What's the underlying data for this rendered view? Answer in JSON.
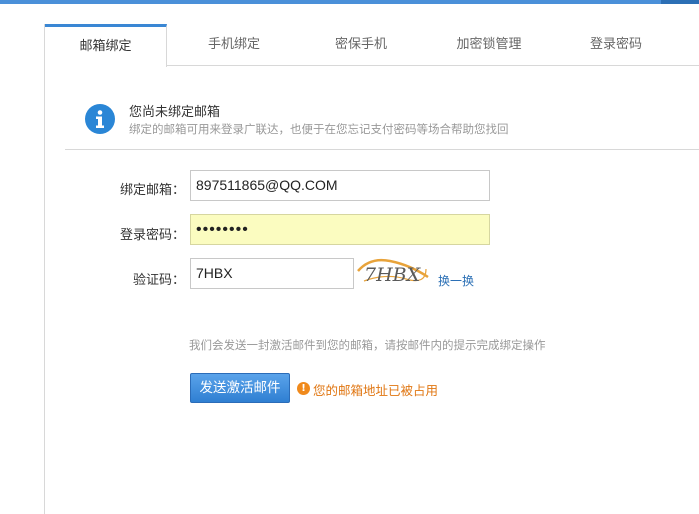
{
  "tabs": [
    {
      "label": "邮箱绑定",
      "active": true
    },
    {
      "label": "手机绑定",
      "active": false
    },
    {
      "label": "密保手机",
      "active": false
    },
    {
      "label": "加密锁管理",
      "active": false
    },
    {
      "label": "登录密码",
      "active": false
    }
  ],
  "notice": {
    "title": "您尚未绑定邮箱",
    "subtitle": "绑定的邮箱可用来登录广联达，也便于在您忘记支付密码等场合帮助您找回",
    "icon": "info-icon",
    "icon_color": "#2a86d6"
  },
  "form": {
    "email_label": "绑定邮箱：",
    "email_value": "897511865@QQ.COM",
    "password_label": "登录密码：",
    "password_value": "••••••••",
    "captcha_label": "验证码：",
    "captcha_value": "7HBX",
    "captcha_image_text": "7HBX",
    "refresh_label": "换一换"
  },
  "tip": "我们会发送一封激活邮件到您的邮箱，请按邮件内的提示完成绑定操作",
  "send_button": "发送激活邮件",
  "error": {
    "icon": "warning-icon",
    "text": "您的邮箱地址已被占用",
    "color": "#e07612"
  }
}
